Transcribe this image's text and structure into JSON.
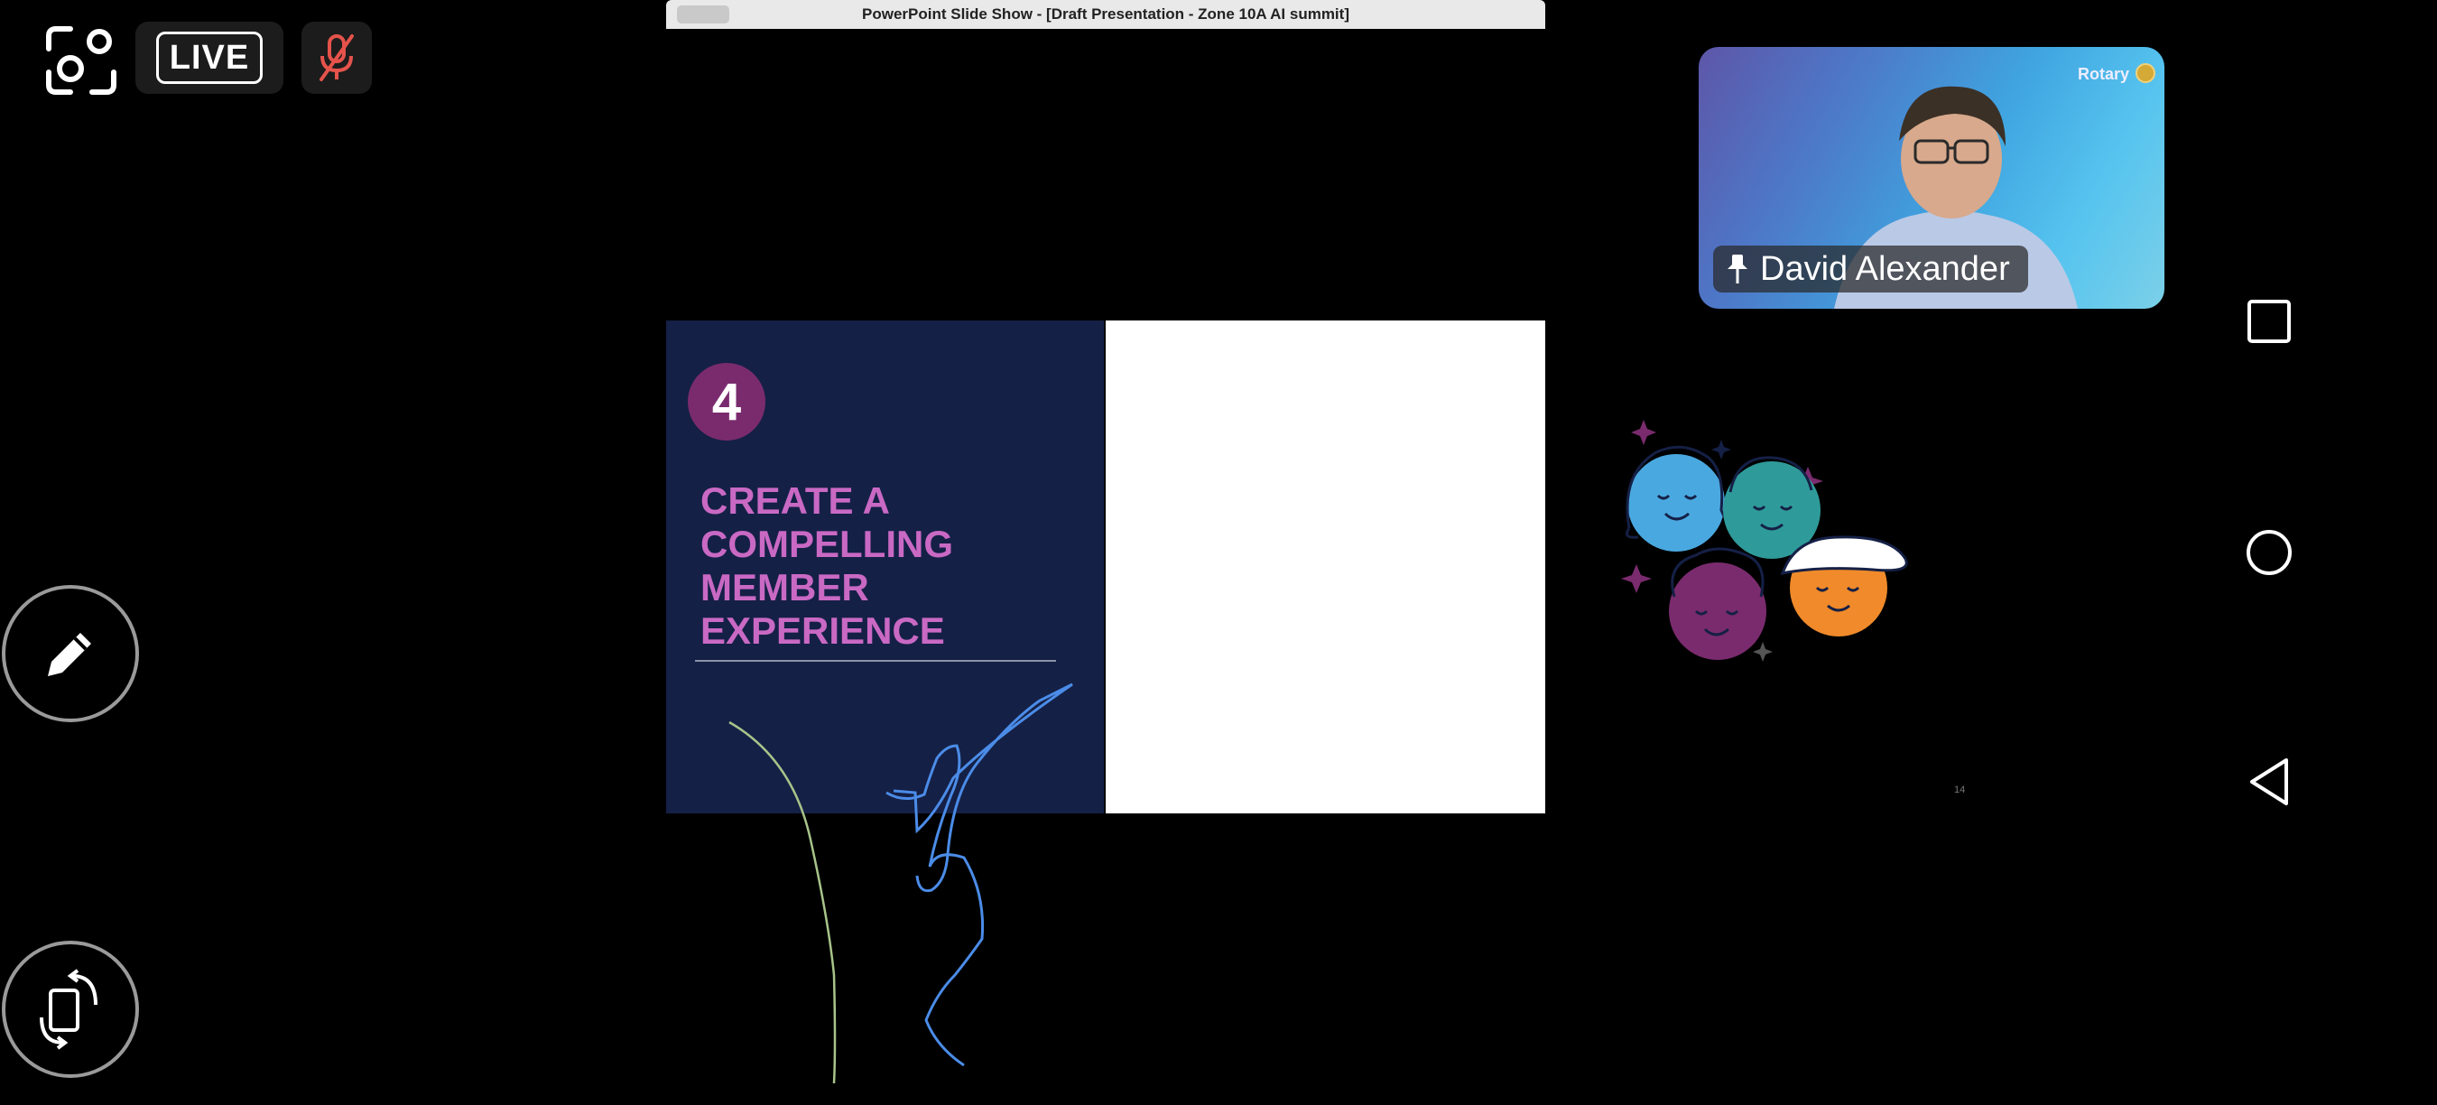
{
  "top_controls": {
    "live_label": "LIVE",
    "scan_icon": "scan-frame-icon",
    "mic_icon": "mic-muted-icon",
    "mic_color": "#e5534b"
  },
  "left_controls": {
    "pen_icon": "pencil-icon",
    "rotate_icon": "rotate-screen-icon"
  },
  "shared_window": {
    "title": "PowerPoint Slide Show - [Draft Presentation - Zone 10A AI summit]",
    "slide": {
      "number": "4",
      "heading": "CREATE A\nCOMPELLING\nMEMBER\nEXPERIENCE",
      "page_number": "14",
      "colors": {
        "left_panel": "#152046",
        "heading": "#c969c4",
        "number_badge": "#7a2b6e",
        "face_blue": "#4aa8e0",
        "face_teal": "#2f9a9a",
        "face_purple": "#7a2b6e",
        "face_orange": "#f08a2a"
      }
    }
  },
  "video": {
    "participant_name": "David Alexander",
    "pin_icon": "pin-icon",
    "brand_label": "Rotary"
  },
  "nav": {
    "recents_icon": "square-icon",
    "home_icon": "circle-icon",
    "back_icon": "triangle-back-icon"
  }
}
